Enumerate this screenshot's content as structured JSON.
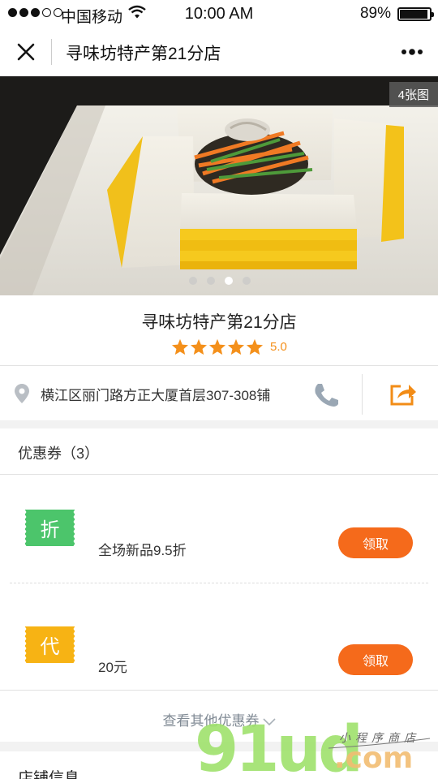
{
  "status_bar": {
    "carrier": "中国移动",
    "time": "10:00 AM",
    "battery": "89%"
  },
  "nav": {
    "title": "寻味坊特产第21分店"
  },
  "hero": {
    "photo_count": "4张图",
    "slides": 4,
    "active_slide": 3
  },
  "store": {
    "name": "寻味坊特产第21分店",
    "rating": 5,
    "rating_text": "5.0",
    "address": "横江区丽门路方正大厦首层307-308铺"
  },
  "coupons": {
    "header": "优惠券（3）",
    "items": [
      {
        "badge": "折",
        "badge_color": "#4cc56b",
        "description": "全场新品9.5折",
        "button": "领取"
      },
      {
        "badge": "代",
        "badge_color": "#f7b314",
        "description": "20元",
        "button": "领取"
      }
    ],
    "more": "查看其他优惠券"
  },
  "info": {
    "title": "店铺信息"
  },
  "watermark": {
    "main": "91ud",
    "domain": ".com",
    "tagline": "小程序商店"
  },
  "colors": {
    "accent": "#f56a1b",
    "star": "#f4901b"
  }
}
